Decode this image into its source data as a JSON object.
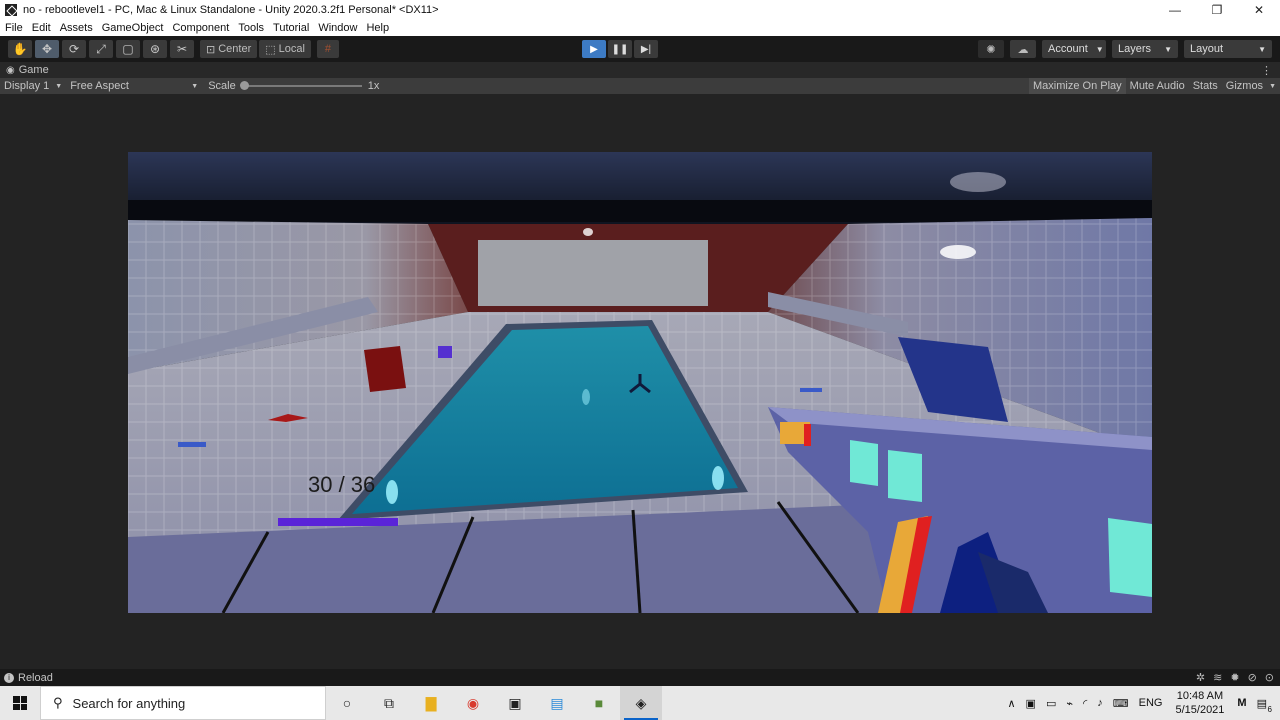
{
  "window": {
    "title": "no - rebootlevel1 - PC, Mac & Linux Standalone - Unity 2020.3.2f1 Personal* <DX11>",
    "minimize": "—",
    "maximize": "❐",
    "close": "✕"
  },
  "menu": {
    "items": [
      "File",
      "Edit",
      "Assets",
      "GameObject",
      "Component",
      "Tools",
      "Tutorial",
      "Window",
      "Help"
    ]
  },
  "toolbar": {
    "tools": [
      {
        "icon": "hand-icon",
        "glyph": "✋"
      },
      {
        "icon": "move-icon",
        "glyph": "✥"
      },
      {
        "icon": "rotate-icon",
        "glyph": "⟳"
      },
      {
        "icon": "scale-icon",
        "glyph": "⤢"
      },
      {
        "icon": "rect-icon",
        "glyph": "▢"
      },
      {
        "icon": "transform-icon",
        "glyph": "⊛"
      },
      {
        "icon": "custom-tool-icon",
        "glyph": "✂"
      }
    ],
    "pivot_label": "Center",
    "space_label": "Local",
    "play": "▶",
    "pause": "❚❚",
    "step": "▶|",
    "account_label": "Account",
    "layers_label": "Layers",
    "layout_label": "Layout"
  },
  "game_tab": {
    "label": "Game",
    "display": "Display 1",
    "aspect": "Free Aspect",
    "scale_label": "Scale",
    "scale_value": "1x",
    "maximize_on_play": "Maximize On Play",
    "mute_audio": "Mute Audio",
    "stats": "Stats",
    "gizmos": "Gizmos"
  },
  "game": {
    "ammo": "30 / 36"
  },
  "status": {
    "message": "Reload"
  },
  "taskbar": {
    "search_placeholder": "Search for anything",
    "language": "ENG",
    "time": "10:48 AM",
    "date": "5/15/2021",
    "notification_count": "6"
  },
  "colors": {
    "play_active": "#3d7bc4",
    "editor_bg": "#232323"
  }
}
